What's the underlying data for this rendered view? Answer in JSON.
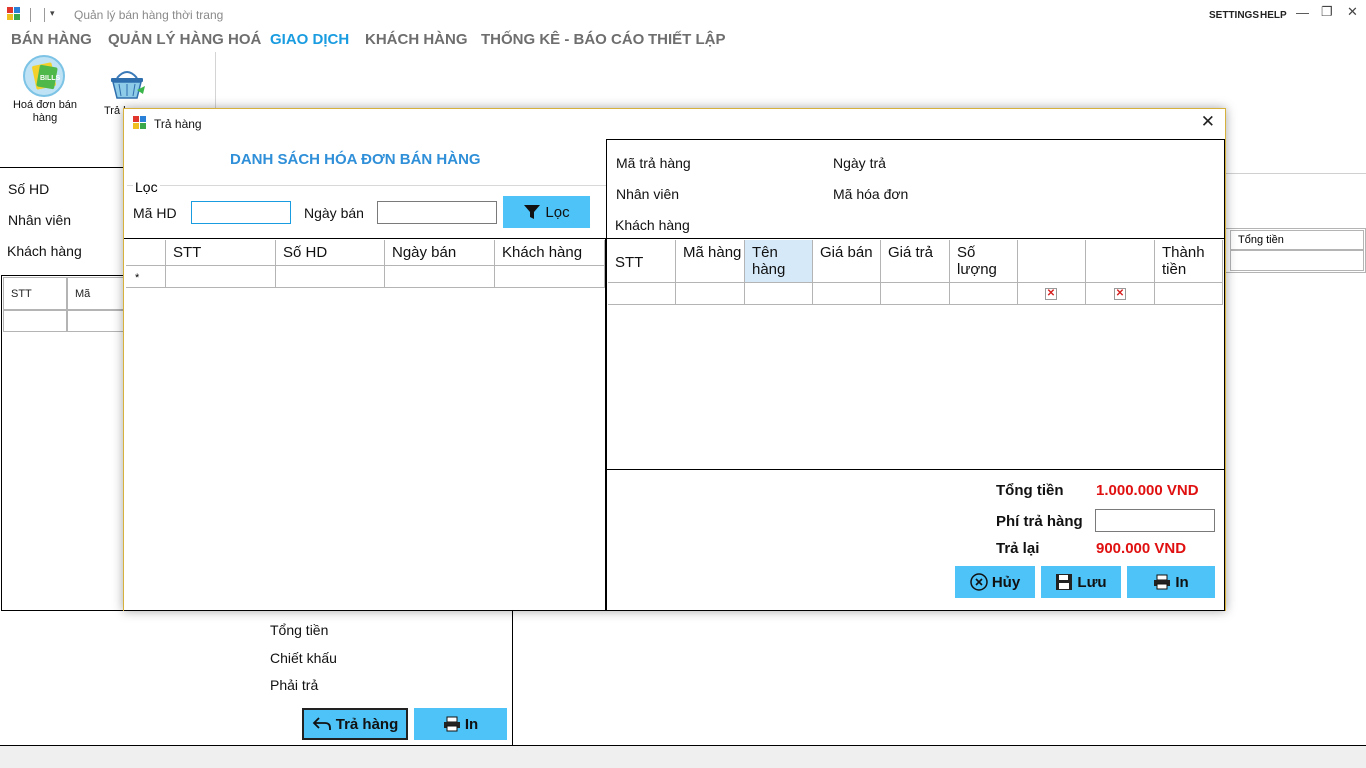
{
  "app": {
    "title": "Quản lý bán hàng thời trang",
    "settings": "SETTINGS",
    "help": "HELP",
    "qa_arrow": "▾",
    "min_glyph": "—",
    "restore_glyph": "❐",
    "close_glyph": "✕"
  },
  "menu": [
    "BÁN HÀNG",
    "QUẢN LÝ HÀNG HOÁ",
    "GIAO DỊCH",
    "KHÁCH HÀNG",
    "THỐNG KÊ - BÁO CÁO",
    "THIẾT LẬP"
  ],
  "menu_active": "GIAO DỊCH",
  "ribbon": {
    "bills_icon_text": "BILLS",
    "invoice_label": "Hoá đơn bán hàng",
    "return_label": "Trả h"
  },
  "background_form": {
    "labels": [
      "Số HD",
      "Nhân viên",
      "Khách hàng"
    ],
    "grid_headers": [
      "STT",
      "Mã"
    ],
    "right_grid_header": "Tổng tiền",
    "summary": [
      "Tổng tiền",
      "Chiết khấu",
      "Phải trả"
    ],
    "return_button": "Trả hàng",
    "print_button": "In"
  },
  "dialog": {
    "title": "Trả hàng",
    "close_glyph": "✕",
    "heading": "DANH SÁCH HÓA ĐƠN BÁN HÀNG",
    "filter": {
      "group": "Lọc",
      "invoice_label": "Mã HD",
      "invoice_value": "",
      "date_label": "Ngày bán",
      "date_value": "",
      "button": "Lọc"
    },
    "invoice_grid": {
      "headers": [
        "STT",
        "Số HD",
        "Ngày bán",
        "Khách hàng"
      ],
      "new_row_marker": "*"
    },
    "info": {
      "return_code": "Mã trả hàng",
      "return_date": "Ngày trả",
      "staff": "Nhân viên",
      "invoice_code": "Mã hóa đơn",
      "customer": "Khách hàng"
    },
    "detail_grid": {
      "headers": [
        "STT",
        "Mã hàng",
        "Tên hàng",
        "Giá bán",
        "Giá trả",
        "Số lượng",
        "",
        "",
        "Thành tiền"
      ],
      "delete_glyph": "✕"
    },
    "totals": {
      "total_label": "Tổng tiền",
      "total_value": "1.000.000 VND",
      "fee_label": "Phí trả hàng",
      "fee_value": "",
      "refund_label": "Trả lại",
      "refund_value": "900.000 VND"
    },
    "buttons": {
      "cancel": "Hủy",
      "save": "Lưu",
      "print": "In"
    }
  },
  "colors": {
    "accent": "#1a9ce0",
    "button": "#4dc3f7",
    "money": "#e01010",
    "dialog_border": "#d6b23c"
  }
}
